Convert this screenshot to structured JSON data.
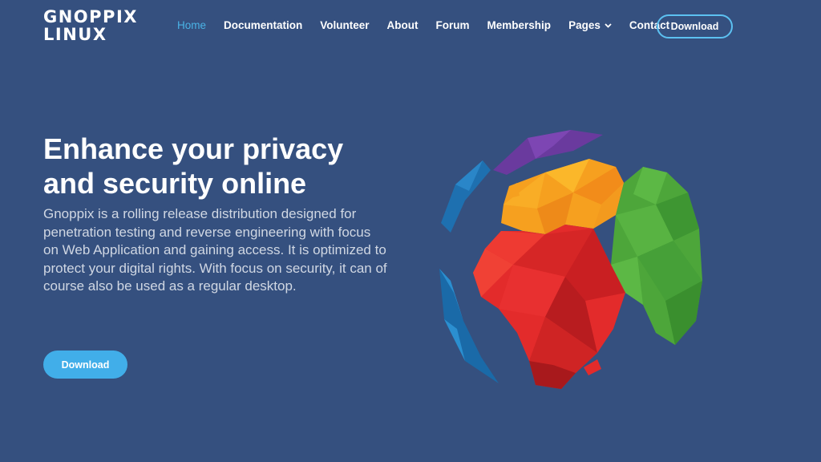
{
  "brand": {
    "line1": "GNOPPIX",
    "line2": "LINUX"
  },
  "nav": {
    "home": "Home",
    "documentation": "Documentation",
    "volunteer": "Volunteer",
    "about": "About",
    "forum": "Forum",
    "membership": "Membership",
    "pages": "Pages",
    "contact": "Contact",
    "download": "Download"
  },
  "hero": {
    "title_line1": "Enhance your privacy",
    "title_line2": "and security online",
    "description": "Gnoppix is a rolling release distribution designed for penetration testing and reverse engineering with focus on Web Application and gaining access. It is optimized to protect your digital rights. With focus on security, it can of course also be used as a regular desktop.",
    "cta_label": "Download"
  },
  "colors": {
    "background": "#35507f",
    "accent": "#41aee9",
    "active_link": "#4ab3e6"
  },
  "icons": {
    "pages_dropdown": "chevron-down-icon",
    "hero_image": "polygon-globe-image"
  }
}
